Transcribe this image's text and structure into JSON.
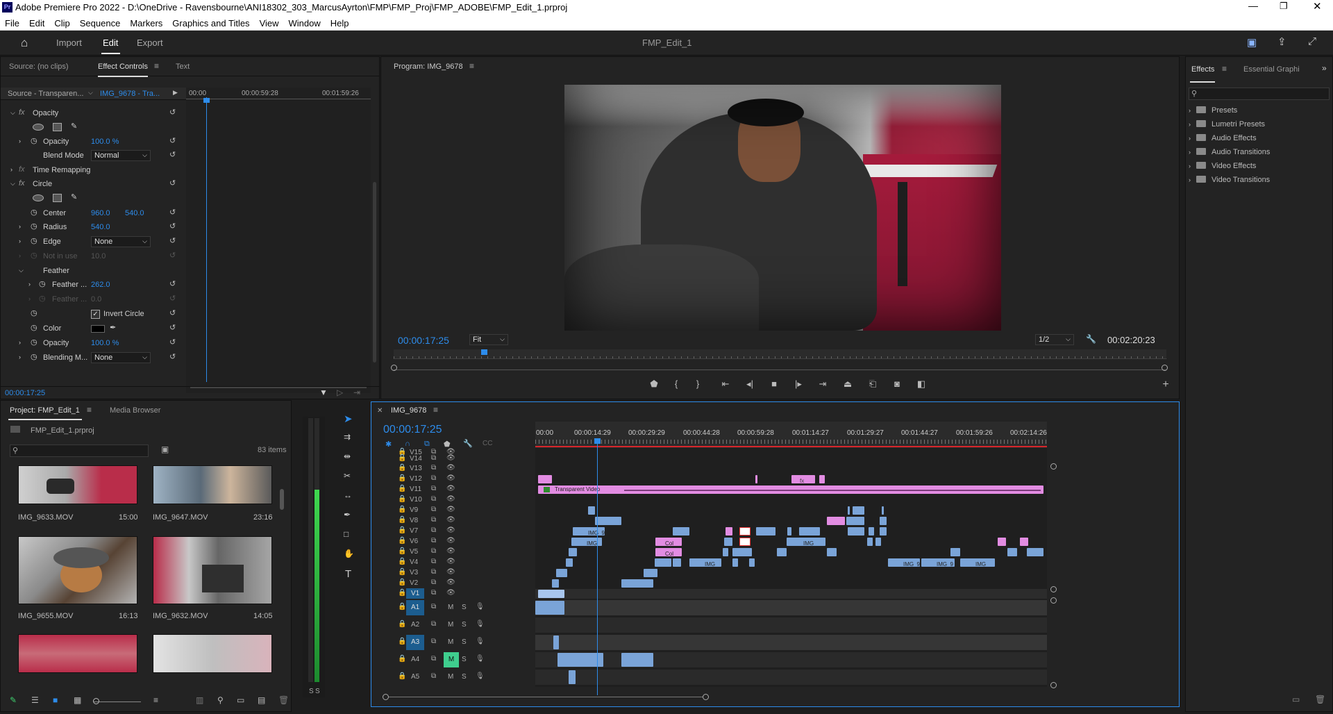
{
  "window": {
    "title": "Adobe Premiere Pro 2022 - D:\\OneDrive - Ravensbourne\\ANI18302_303_MarcusAyrton\\FMP\\FMP_Proj\\FMP_ADOBE\\FMP_Edit_1.prproj",
    "app_badge": "Pr"
  },
  "menu": [
    "File",
    "Edit",
    "Clip",
    "Sequence",
    "Markers",
    "Graphics and Titles",
    "View",
    "Window",
    "Help"
  ],
  "workspace": {
    "tabs": [
      "Import",
      "Edit",
      "Export"
    ],
    "project_name": "FMP_Edit_1"
  },
  "effect_controls": {
    "tabs": [
      "Source: (no clips)",
      "Effect Controls",
      "Text"
    ],
    "source_label": "Source - Transparen...",
    "clip_label": "IMG_9678 - Tra...",
    "ruler": [
      "00:00",
      "00:00:59:28",
      "00:01:59:26"
    ],
    "rows": {
      "opacity_section": "Opacity",
      "opacity_label": "Opacity",
      "opacity_value": "100.0 %",
      "blend_label": "Blend Mode",
      "blend_value": "Normal",
      "time_remap": "Time Remapping",
      "circle": "Circle",
      "center_label": "Center",
      "center_x": "960.0",
      "center_y": "540.0",
      "radius_label": "Radius",
      "radius_value": "540.0",
      "edge_label": "Edge",
      "edge_value": "None",
      "notinuse_label": "Not in use",
      "notinuse_value": "10.0",
      "feather": "Feather",
      "feather1_label": "Feather ...",
      "feather1_value": "262.0",
      "feather2_label": "Feather ...",
      "feather2_value": "0.0",
      "invert_label": "Invert Circle",
      "color_label": "Color",
      "opacity2_label": "Opacity",
      "opacity2_value": "100.0 %",
      "blending_label": "Blending M...",
      "blending_value": "None"
    },
    "timecode": "00:00:17:25"
  },
  "program": {
    "title": "Program: IMG_9678",
    "timecode": "00:00:17:25",
    "fit": "Fit",
    "resolution": "1/2",
    "duration": "00:02:20:23"
  },
  "effects": {
    "tabs": [
      "Effects",
      "Essential Graphics"
    ],
    "folders": [
      "Presets",
      "Lumetri Presets",
      "Audio Effects",
      "Audio Transitions",
      "Video Effects",
      "Video Transitions"
    ]
  },
  "project": {
    "tabs": [
      "Project: FMP_Edit_1",
      "Media Browser"
    ],
    "file": "FMP_Edit_1.prproj",
    "items_count": "83 items",
    "items": [
      {
        "name": "IMG_9633.MOV",
        "dur": "15:00"
      },
      {
        "name": "IMG_9647.MOV",
        "dur": "23:16"
      },
      {
        "name": "IMG_9655.MOV",
        "dur": "16:13"
      },
      {
        "name": "IMG_9632.MOV",
        "dur": "14:05"
      }
    ]
  },
  "meter": {
    "labels": [
      "S",
      "S"
    ],
    "level_left": 0.0,
    "level_right": 0.73
  },
  "timeline": {
    "title": "IMG_9678",
    "timecode": "00:00:17:25",
    "ruler": [
      "00:00",
      "00:00:14:29",
      "00:00:29:29",
      "00:00:44:28",
      "00:00:59:28",
      "00:01:14:27",
      "00:01:29:27",
      "00:01:44:27",
      "00:01:59:26",
      "00:02:14:26"
    ],
    "video_tracks": [
      "V15",
      "V14",
      "V13",
      "V12",
      "V11",
      "V10",
      "V9",
      "V8",
      "V7",
      "V6",
      "V5",
      "V4",
      "V3",
      "V2",
      "V1"
    ],
    "audio_tracks": [
      "A1",
      "A2",
      "A3",
      "A4",
      "A5"
    ],
    "clip_labels": {
      "transparent": "Transparent Video",
      "img9a": "IMG_9",
      "img_b": "IMG_",
      "col": "Col",
      "img_c": "IMG_",
      "img_d": "IMG_9",
      "img_e": "IMG_9",
      "img_f": "IMG_",
      "fx": "fx"
    },
    "msr": [
      "M",
      "S"
    ]
  }
}
